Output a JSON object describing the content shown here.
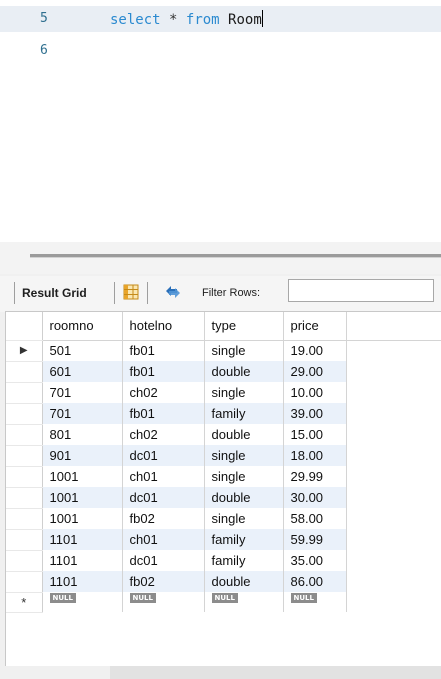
{
  "editor": {
    "lines": [
      {
        "number": "5",
        "keyword": "select",
        "operator": "*",
        "from_keyword": "from",
        "table": "Room"
      },
      {
        "number": "6"
      }
    ]
  },
  "toolbar": {
    "result_grid_label": "Result Grid",
    "filter_rows_label": "Filter Rows:",
    "filter_rows_value": "",
    "icons": [
      "grid-layout-icon",
      "refresh-arrows-icon"
    ],
    "colors": {
      "grid_icon": "#e8a42a",
      "refresh_icon": "#2a6fb8"
    }
  },
  "grid": {
    "columns": [
      "roomno",
      "hotelno",
      "type",
      "price"
    ],
    "rows": [
      [
        "501",
        "fb01",
        "single",
        "19.00"
      ],
      [
        "601",
        "fb01",
        "double",
        "29.00"
      ],
      [
        "701",
        "ch02",
        "single",
        "10.00"
      ],
      [
        "701",
        "fb01",
        "family",
        "39.00"
      ],
      [
        "801",
        "ch02",
        "double",
        "15.00"
      ],
      [
        "901",
        "dc01",
        "single",
        "18.00"
      ],
      [
        "1001",
        "ch01",
        "single",
        "29.99"
      ],
      [
        "1001",
        "dc01",
        "double",
        "30.00"
      ],
      [
        "1001",
        "fb02",
        "single",
        "58.00"
      ],
      [
        "1101",
        "ch01",
        "family",
        "59.99"
      ],
      [
        "1101",
        "dc01",
        "family",
        "35.00"
      ],
      [
        "1101",
        "fb02",
        "double",
        "86.00"
      ]
    ],
    "current_row_marker": "▶",
    "new_row_marker": "*",
    "null_label": "NULL",
    "row_stripe_color": "#eaf1fa"
  }
}
